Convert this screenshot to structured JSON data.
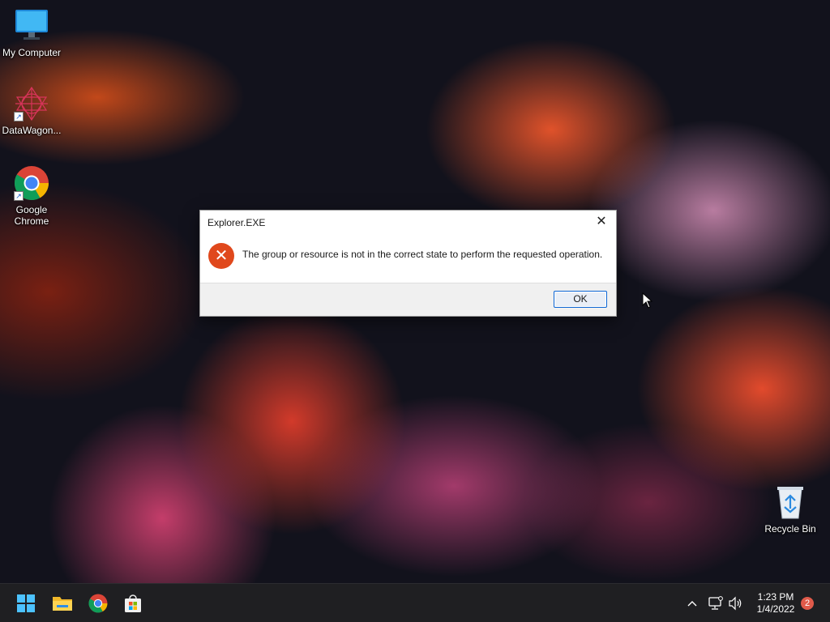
{
  "desktop": {
    "icons": [
      {
        "label": "My Computer",
        "icon": "monitor-icon"
      },
      {
        "label": "DataWagon...",
        "icon": "datawagon-icon"
      },
      {
        "label": "Google Chrome",
        "icon": "chrome-icon"
      },
      {
        "label": "Recycle Bin",
        "icon": "recycle-bin-icon"
      }
    ]
  },
  "dialog": {
    "title": "Explorer.EXE",
    "message": "The group or resource is not in the correct state to perform the requested operation.",
    "ok_label": "OK",
    "close_glyph": "✕",
    "error_glyph": "✕"
  },
  "taskbar": {
    "apps": [
      {
        "name": "start",
        "icon": "windows-start-icon"
      },
      {
        "name": "file-explorer",
        "icon": "folder-icon"
      },
      {
        "name": "chrome",
        "icon": "chrome-icon"
      },
      {
        "name": "store",
        "icon": "store-icon"
      }
    ],
    "tray": {
      "chevron": "^",
      "time": "1:23 PM",
      "date": "1/4/2022",
      "notification_count": "2"
    }
  },
  "colors": {
    "error": "#e0481c",
    "accent": "#0a64d4",
    "taskbar": "#1f1f22"
  }
}
